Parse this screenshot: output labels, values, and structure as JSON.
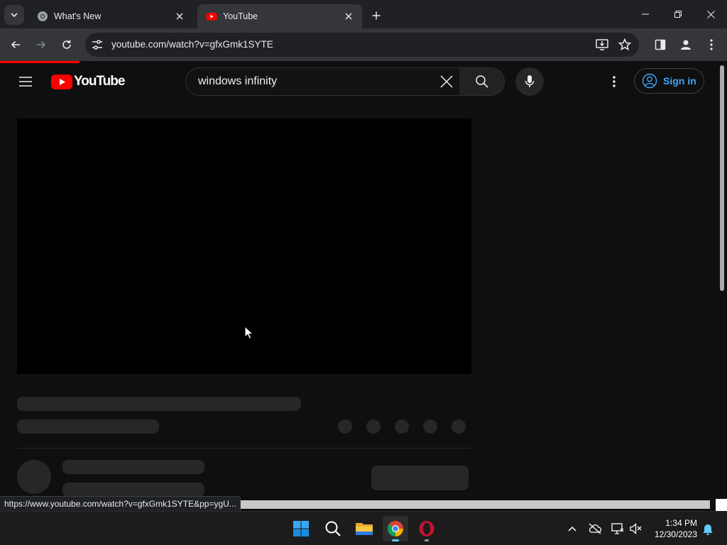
{
  "browser": {
    "tabs": [
      {
        "title": "What's New",
        "active": false
      },
      {
        "title": "YouTube",
        "active": true
      }
    ],
    "address_bar": {
      "url": "youtube.com/watch?v=gfxGmk1SYTE"
    },
    "status_url": "https://www.youtube.com/watch?v=gfxGmk1SYTE&pp=ygU...",
    "colors": {
      "frame": "#202124",
      "toolbar": "#35363a",
      "accent": "#ff0000"
    }
  },
  "youtube": {
    "logo_text": "YouTube",
    "search": {
      "query": "windows infinity"
    },
    "sign_in_label": "Sign in",
    "colors": {
      "background": "#0f0f0f",
      "skeleton": "#272727",
      "link": "#3ea6ff"
    }
  },
  "taskbar": {
    "apps": [
      "start-icon",
      "search-icon",
      "file-explorer-icon",
      "chrome-icon",
      "opera-icon"
    ],
    "clock": {
      "time": "1:34 PM",
      "date": "12/30/2023"
    }
  }
}
